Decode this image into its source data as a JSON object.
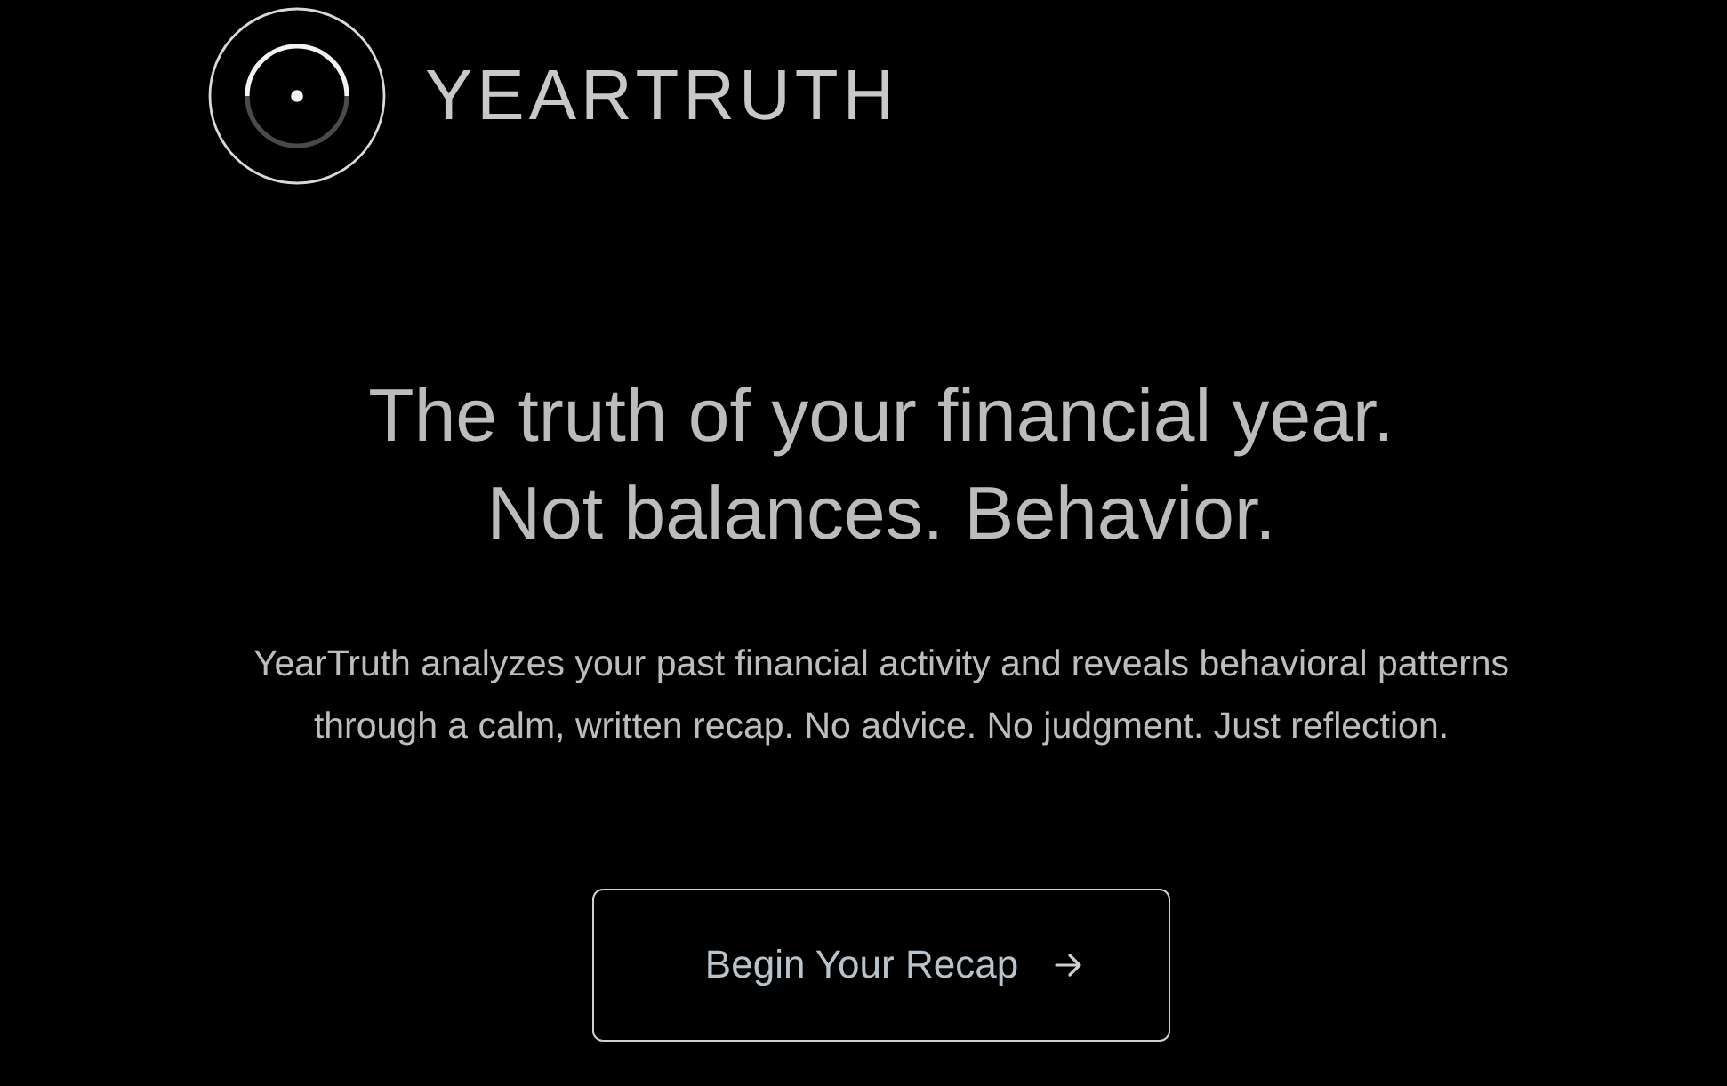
{
  "brand": {
    "name": "YEARTRUTH"
  },
  "hero": {
    "headline": [
      "The truth of your financial year.",
      "Not balances. Behavior."
    ],
    "description": "YearTruth analyzes your past financial activity and reveals behavioral patterns through a calm, written recap. No advice. No judgment. Just reflection.",
    "cta": {
      "label": "Begin Your Recap"
    }
  }
}
